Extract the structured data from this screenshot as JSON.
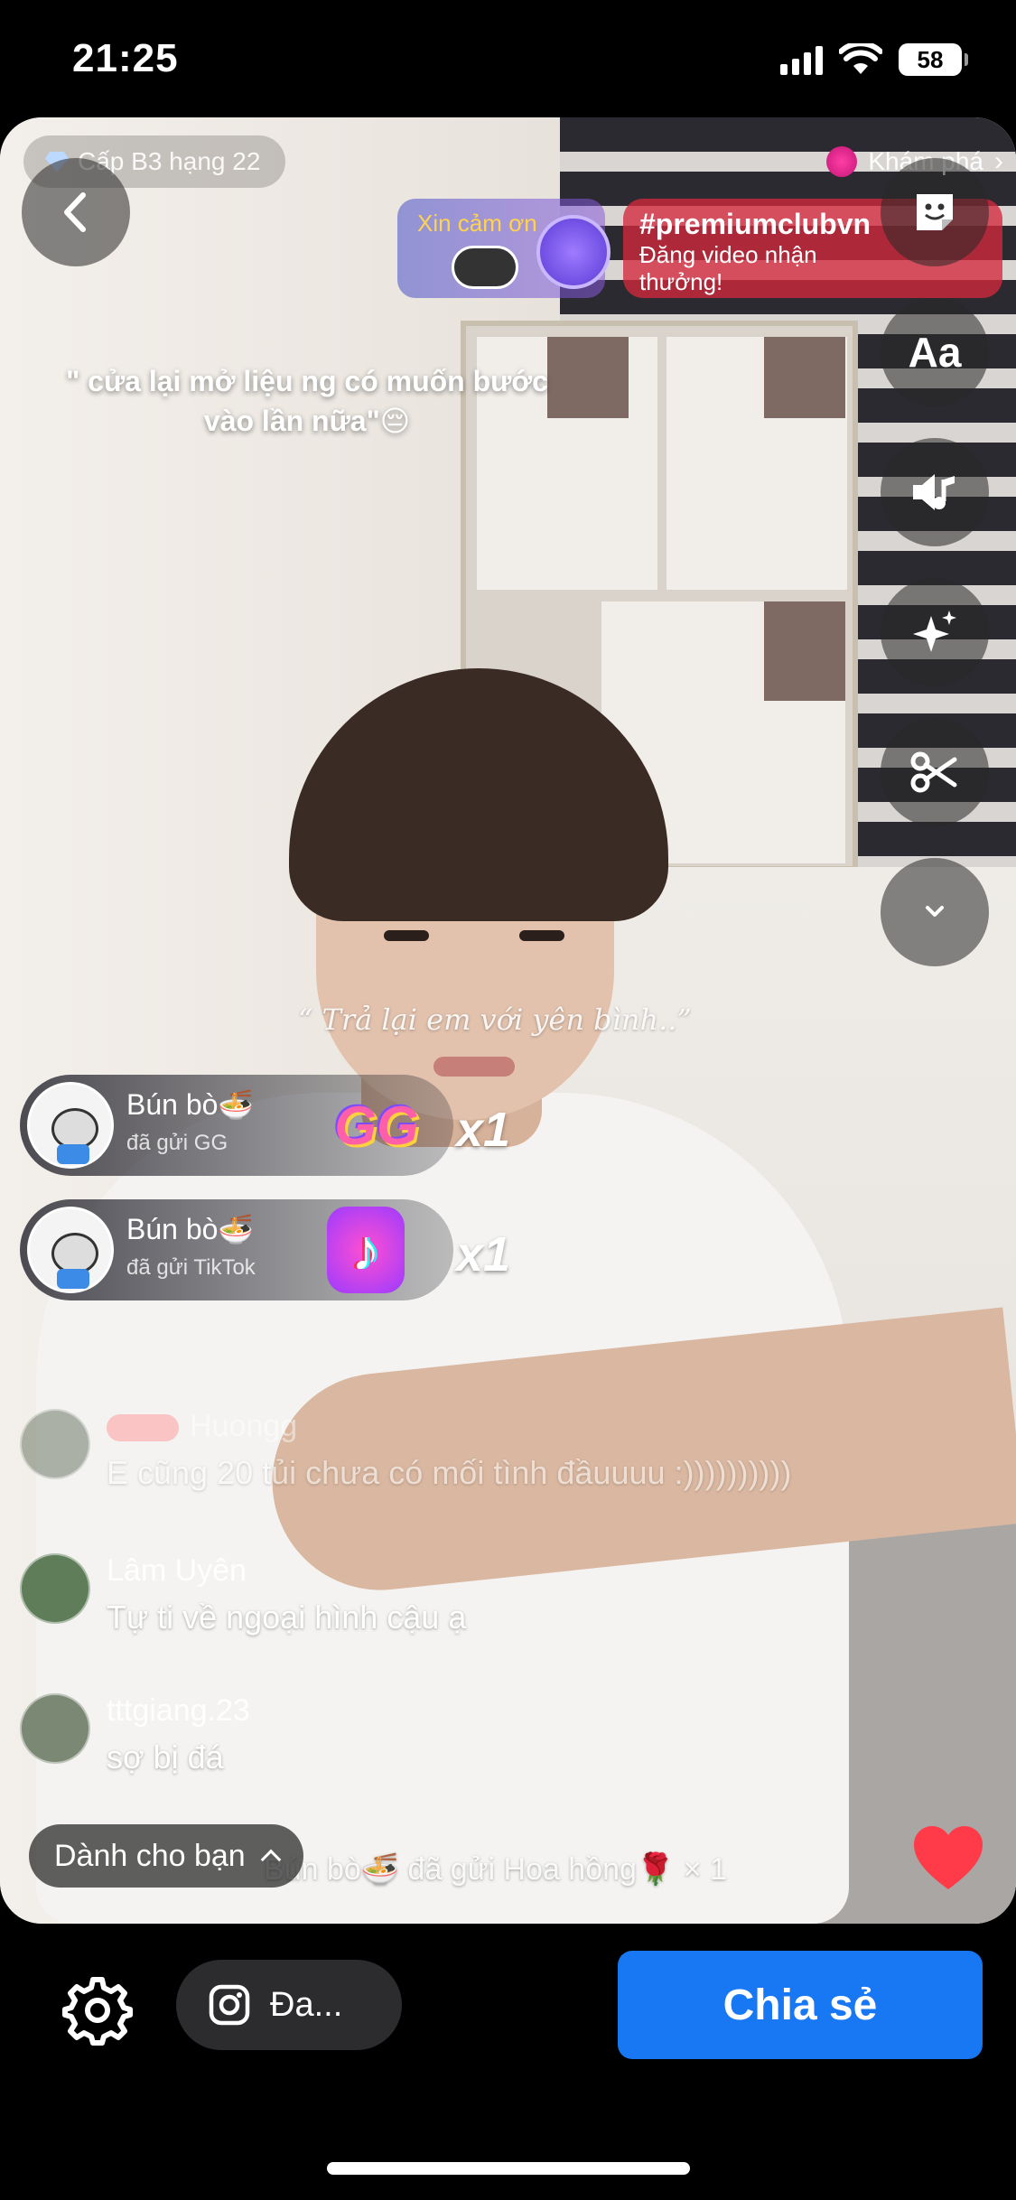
{
  "status_bar": {
    "time": "21:25",
    "battery": "58"
  },
  "overlay": {
    "rank": "Cấp B3 hạng 22",
    "explore": "Khám phá",
    "thanks": "Xin cảm ơn",
    "promo_tag": "#premiumclubvn",
    "promo_sub": "Đăng video nhận thưởng!",
    "quote_top": "\" cửa lại mở liệu ng có muốn bước vào lần nữa\"😔",
    "quote_mid": "“ Trả lại em với yên bình..”"
  },
  "gifts": [
    {
      "name": "Bún bò🍜",
      "action": "đã gửi GG",
      "icon": "GG",
      "count": "x1"
    },
    {
      "name": "Bún bò🍜",
      "action": "đã gửi TikTok",
      "icon": "♪",
      "count": "x1"
    }
  ],
  "comments": [
    {
      "name": "Huongg",
      "text": "E cũng 20 tủi chưa có mối tình đầuuuu :))))))))))"
    },
    {
      "name": "Lâm Uyên",
      "text": "Tự ti về ngoại hình cậu ạ"
    },
    {
      "name": "tttgiang.23",
      "text": "sợ bị đá"
    }
  ],
  "for_you": "Dành cho bạn",
  "bottom_gift": "Bún bò🍜 đã gửi Hoa hồng🌹 × 1",
  "bottom_bar": {
    "ig_label": "Đa...",
    "share_label": "Chia sẻ"
  },
  "colors": {
    "share": "#1877f2",
    "promo": "#d2283c",
    "heart": "#ff3b4a"
  },
  "icons": [
    "back-icon",
    "sticker-icon",
    "text-icon",
    "music-icon",
    "sparkle-icon",
    "scissors-icon",
    "chevron-down-icon",
    "heart-icon",
    "gear-icon",
    "instagram-icon"
  ]
}
